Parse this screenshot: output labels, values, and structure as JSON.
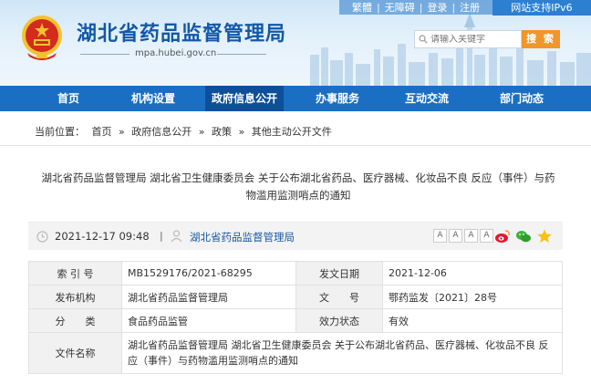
{
  "header": {
    "site_title": "湖北省药品监督管理局",
    "site_url": "mpa.hubei.gov.cn",
    "top_links": [
      "繁體",
      "无障碍",
      "登录",
      "注册"
    ],
    "ipv6_label": "网站支持IPv6",
    "search_placeholder": "请输入关键字",
    "search_button": "搜 索"
  },
  "nav": {
    "items": [
      {
        "label": "首页"
      },
      {
        "label": "机构设置"
      },
      {
        "label": "政府信息公开"
      },
      {
        "label": "办事服务"
      },
      {
        "label": "互动交流"
      },
      {
        "label": "部门动态"
      }
    ],
    "active_index": 2
  },
  "breadcrumb": {
    "prefix": "当前位置：",
    "items": [
      "首页",
      "政府信息公开",
      "政策",
      "其他主动公开文件"
    ],
    "separator": "»"
  },
  "article": {
    "title": "湖北省药品监督管理局 湖北省卫生健康委员会 关于公布湖北省药品、医疗器械、化妆品不良 反应（事件）与药物滥用监测哨点的通知",
    "date": "2021-12-17 09:48",
    "divider": "|",
    "source": "湖北省药品监督管理局",
    "font_sizes": [
      "A",
      "A",
      "A",
      "A"
    ]
  },
  "info_table": {
    "index_label": "索 引 号",
    "index_value": "MB1529176/2021-68295",
    "date_label": "发文日期",
    "date_value": "2021-12-06",
    "issuer_label": "发布机构",
    "issuer_value": "湖北省药品监督管理局",
    "docno_label": "文　　号",
    "docno_value": "鄂药监发〔2021〕28号",
    "category_label": "分　　类",
    "category_value": "食品药品监管",
    "status_label": "效力状态",
    "status_value": "有效",
    "filename_label": "文件名称",
    "filename_value": "湖北省药品监督管理局 湖北省卫生健康委员会 关于公布湖北省药品、医疗器械、化妆品不良 反应（事件）与药物滥用监测哨点的通知"
  },
  "colors": {
    "nav_bg": "#1a6fc4",
    "nav_active": "#0e4f99",
    "title_blue": "#1358a8",
    "search_button": "#f0962a",
    "emblem_red": "#d32b1e",
    "emblem_gold": "#f2c230"
  },
  "icons": [
    "national-emblem-icon",
    "search-icon",
    "clock-icon",
    "person-icon",
    "weibo-icon",
    "wechat-icon",
    "favorite-star-icon"
  ]
}
